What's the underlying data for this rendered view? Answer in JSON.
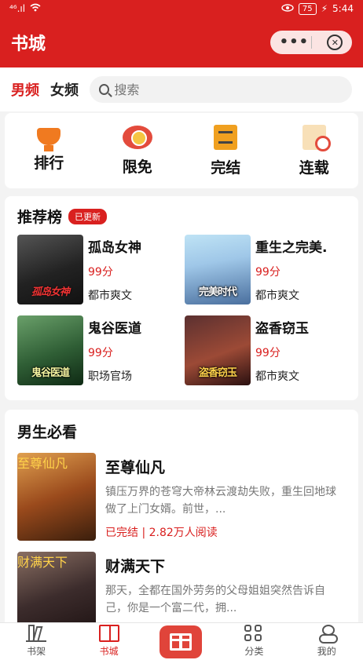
{
  "status": {
    "signal": "⁴⁶.ıl",
    "time": "5:44",
    "battery": "75"
  },
  "appbar": {
    "title": "书城"
  },
  "tabs": [
    {
      "label": "男频"
    },
    {
      "label": "女频"
    }
  ],
  "search": {
    "placeholder": "搜索"
  },
  "quick_entries": [
    {
      "label": "排行",
      "icon": "trophy-icon"
    },
    {
      "label": "限免",
      "icon": "clock-icon"
    },
    {
      "label": "完结",
      "icon": "book-icon"
    },
    {
      "label": "连载",
      "icon": "serial-icon"
    }
  ],
  "ranking": {
    "title": "推荐榜",
    "badge": "已更新",
    "books": [
      {
        "name": "孤岛女神",
        "score": "99分",
        "genre": "都市爽文",
        "cover_text": "孤岛女神"
      },
      {
        "name": "重生之完美.",
        "score": "99分",
        "genre": "都市爽文",
        "cover_text": "完美时代"
      },
      {
        "name": "鬼谷医道",
        "score": "99分",
        "genre": "职场官场",
        "cover_text": "鬼谷医道"
      },
      {
        "name": "盗香窃玉",
        "score": "99分",
        "genre": "都市爽文",
        "cover_text": "盗香窃玉"
      }
    ]
  },
  "must_read": {
    "title": "男生必看",
    "books": [
      {
        "name": "至尊仙凡",
        "desc": "镇压万界的苍穹大帝林云渡劫失败，重生回地球做了上门女婿。前世，...",
        "meta": "已完结 | 2.82万人阅读",
        "cover_text": "至尊仙凡"
      },
      {
        "name": "财满天下",
        "desc": "那天，全都在国外劳务的父母姐姐突然告诉自己，你是一个富二代，拥...",
        "meta": "",
        "cover_text": "财满天下"
      }
    ]
  },
  "bottom_nav": [
    {
      "label": "书架"
    },
    {
      "label": "书城"
    },
    {
      "label": "分类"
    },
    {
      "label": "我的"
    }
  ]
}
